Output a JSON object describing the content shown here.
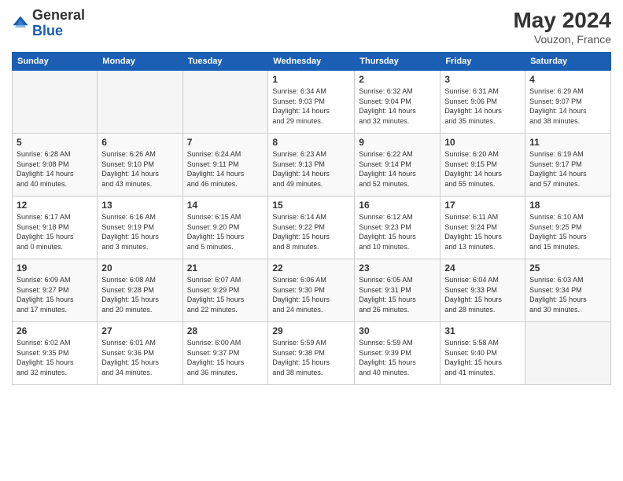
{
  "header": {
    "logo_general": "General",
    "logo_blue": "Blue",
    "month_year": "May 2024",
    "location": "Vouzon, France"
  },
  "days_of_week": [
    "Sunday",
    "Monday",
    "Tuesday",
    "Wednesday",
    "Thursday",
    "Friday",
    "Saturday"
  ],
  "weeks": [
    [
      {
        "day": "",
        "info": ""
      },
      {
        "day": "",
        "info": ""
      },
      {
        "day": "",
        "info": ""
      },
      {
        "day": "1",
        "info": "Sunrise: 6:34 AM\nSunset: 9:03 PM\nDaylight: 14 hours\nand 29 minutes."
      },
      {
        "day": "2",
        "info": "Sunrise: 6:32 AM\nSunset: 9:04 PM\nDaylight: 14 hours\nand 32 minutes."
      },
      {
        "day": "3",
        "info": "Sunrise: 6:31 AM\nSunset: 9:06 PM\nDaylight: 14 hours\nand 35 minutes."
      },
      {
        "day": "4",
        "info": "Sunrise: 6:29 AM\nSunset: 9:07 PM\nDaylight: 14 hours\nand 38 minutes."
      }
    ],
    [
      {
        "day": "5",
        "info": "Sunrise: 6:28 AM\nSunset: 9:08 PM\nDaylight: 14 hours\nand 40 minutes."
      },
      {
        "day": "6",
        "info": "Sunrise: 6:26 AM\nSunset: 9:10 PM\nDaylight: 14 hours\nand 43 minutes."
      },
      {
        "day": "7",
        "info": "Sunrise: 6:24 AM\nSunset: 9:11 PM\nDaylight: 14 hours\nand 46 minutes."
      },
      {
        "day": "8",
        "info": "Sunrise: 6:23 AM\nSunset: 9:13 PM\nDaylight: 14 hours\nand 49 minutes."
      },
      {
        "day": "9",
        "info": "Sunrise: 6:22 AM\nSunset: 9:14 PM\nDaylight: 14 hours\nand 52 minutes."
      },
      {
        "day": "10",
        "info": "Sunrise: 6:20 AM\nSunset: 9:15 PM\nDaylight: 14 hours\nand 55 minutes."
      },
      {
        "day": "11",
        "info": "Sunrise: 6:19 AM\nSunset: 9:17 PM\nDaylight: 14 hours\nand 57 minutes."
      }
    ],
    [
      {
        "day": "12",
        "info": "Sunrise: 6:17 AM\nSunset: 9:18 PM\nDaylight: 15 hours\nand 0 minutes."
      },
      {
        "day": "13",
        "info": "Sunrise: 6:16 AM\nSunset: 9:19 PM\nDaylight: 15 hours\nand 3 minutes."
      },
      {
        "day": "14",
        "info": "Sunrise: 6:15 AM\nSunset: 9:20 PM\nDaylight: 15 hours\nand 5 minutes."
      },
      {
        "day": "15",
        "info": "Sunrise: 6:14 AM\nSunset: 9:22 PM\nDaylight: 15 hours\nand 8 minutes."
      },
      {
        "day": "16",
        "info": "Sunrise: 6:12 AM\nSunset: 9:23 PM\nDaylight: 15 hours\nand 10 minutes."
      },
      {
        "day": "17",
        "info": "Sunrise: 6:11 AM\nSunset: 9:24 PM\nDaylight: 15 hours\nand 13 minutes."
      },
      {
        "day": "18",
        "info": "Sunrise: 6:10 AM\nSunset: 9:25 PM\nDaylight: 15 hours\nand 15 minutes."
      }
    ],
    [
      {
        "day": "19",
        "info": "Sunrise: 6:09 AM\nSunset: 9:27 PM\nDaylight: 15 hours\nand 17 minutes."
      },
      {
        "day": "20",
        "info": "Sunrise: 6:08 AM\nSunset: 9:28 PM\nDaylight: 15 hours\nand 20 minutes."
      },
      {
        "day": "21",
        "info": "Sunrise: 6:07 AM\nSunset: 9:29 PM\nDaylight: 15 hours\nand 22 minutes."
      },
      {
        "day": "22",
        "info": "Sunrise: 6:06 AM\nSunset: 9:30 PM\nDaylight: 15 hours\nand 24 minutes."
      },
      {
        "day": "23",
        "info": "Sunrise: 6:05 AM\nSunset: 9:31 PM\nDaylight: 15 hours\nand 26 minutes."
      },
      {
        "day": "24",
        "info": "Sunrise: 6:04 AM\nSunset: 9:33 PM\nDaylight: 15 hours\nand 28 minutes."
      },
      {
        "day": "25",
        "info": "Sunrise: 6:03 AM\nSunset: 9:34 PM\nDaylight: 15 hours\nand 30 minutes."
      }
    ],
    [
      {
        "day": "26",
        "info": "Sunrise: 6:02 AM\nSunset: 9:35 PM\nDaylight: 15 hours\nand 32 minutes."
      },
      {
        "day": "27",
        "info": "Sunrise: 6:01 AM\nSunset: 9:36 PM\nDaylight: 15 hours\nand 34 minutes."
      },
      {
        "day": "28",
        "info": "Sunrise: 6:00 AM\nSunset: 9:37 PM\nDaylight: 15 hours\nand 36 minutes."
      },
      {
        "day": "29",
        "info": "Sunrise: 5:59 AM\nSunset: 9:38 PM\nDaylight: 15 hours\nand 38 minutes."
      },
      {
        "day": "30",
        "info": "Sunrise: 5:59 AM\nSunset: 9:39 PM\nDaylight: 15 hours\nand 40 minutes."
      },
      {
        "day": "31",
        "info": "Sunrise: 5:58 AM\nSunset: 9:40 PM\nDaylight: 15 hours\nand 41 minutes."
      },
      {
        "day": "",
        "info": ""
      }
    ]
  ]
}
